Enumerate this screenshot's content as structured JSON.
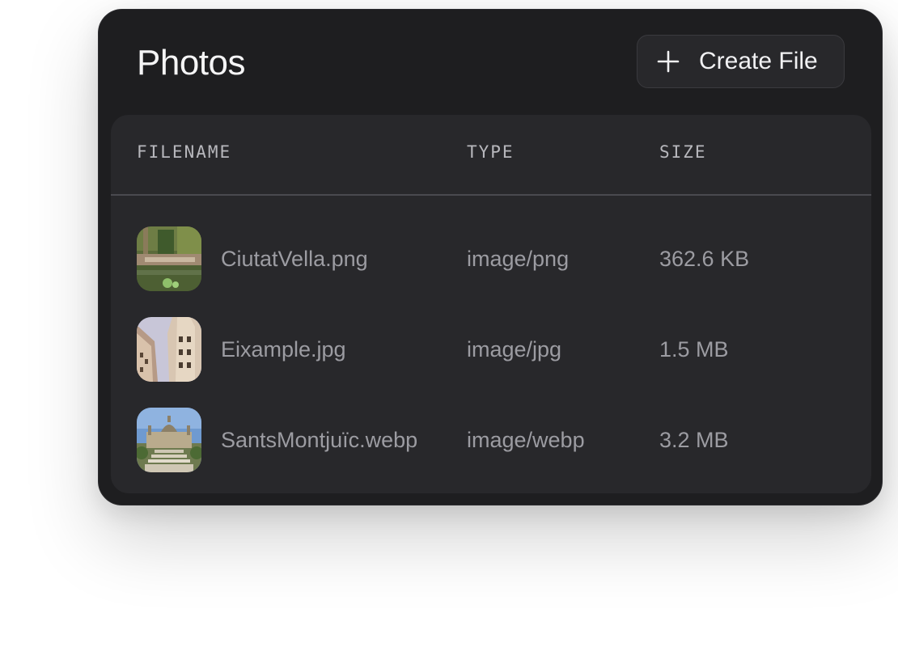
{
  "header": {
    "title": "Photos",
    "create_button_label": "Create File"
  },
  "table": {
    "columns": [
      "FILENAME",
      "TYPE",
      "SIZE"
    ],
    "rows": [
      {
        "filename": "CiutatVella.png",
        "type": "image/png",
        "size": "362.6 KB",
        "thumbnail": "park-pond-photo"
      },
      {
        "filename": "Eixample.jpg",
        "type": "image/jpg",
        "size": "1.5 MB",
        "thumbnail": "buildings-sky-photo"
      },
      {
        "filename": "SantsMontjuïc.webp",
        "type": "image/webp",
        "size": "3.2 MB",
        "thumbnail": "palace-photo"
      }
    ]
  },
  "colors": {
    "card_background": "#1e1e20",
    "panel_background": "#28282b",
    "title_text": "#f4f4f5",
    "cell_text": "#9c9ca2",
    "header_text": "#b8b8bd"
  }
}
